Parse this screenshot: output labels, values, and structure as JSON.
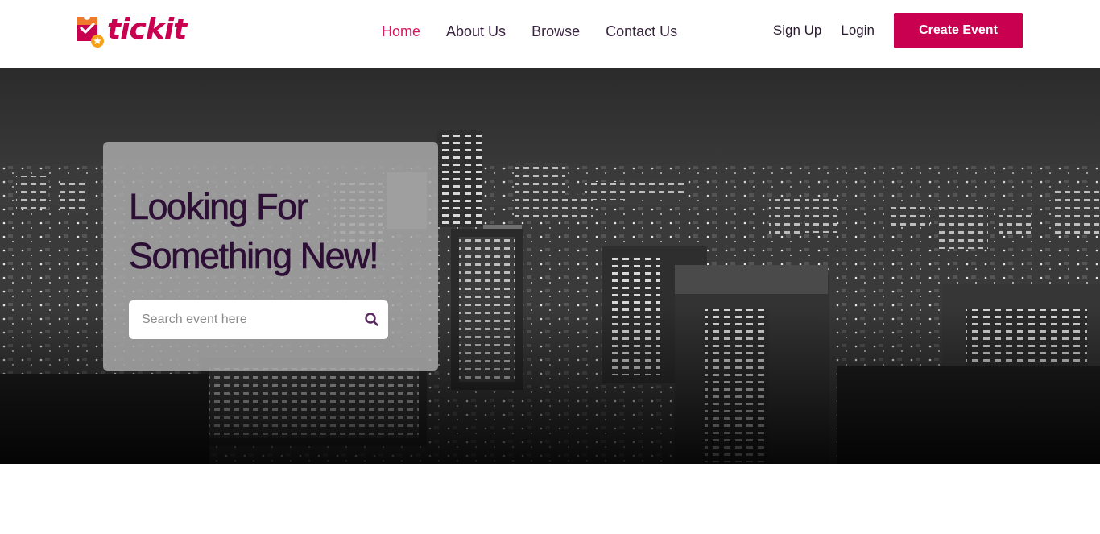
{
  "brand": {
    "name": "tickit",
    "color": "#c9004f",
    "logo_icon": "ticket-check-icon"
  },
  "nav": {
    "items": [
      {
        "label": "Home",
        "active": true
      },
      {
        "label": "About Us",
        "active": false
      },
      {
        "label": "Browse",
        "active": false
      },
      {
        "label": "Contact Us",
        "active": false
      }
    ]
  },
  "auth": {
    "sign_up_label": "Sign Up",
    "login_label": "Login",
    "create_event_label": "Create Event"
  },
  "hero": {
    "headline": "Looking For Something New!",
    "search": {
      "placeholder": "Search event here",
      "value": "",
      "icon": "search-icon"
    }
  },
  "colors": {
    "accent": "#c9004f",
    "nav_active": "#d6185f",
    "heading": "#2d0f36"
  }
}
